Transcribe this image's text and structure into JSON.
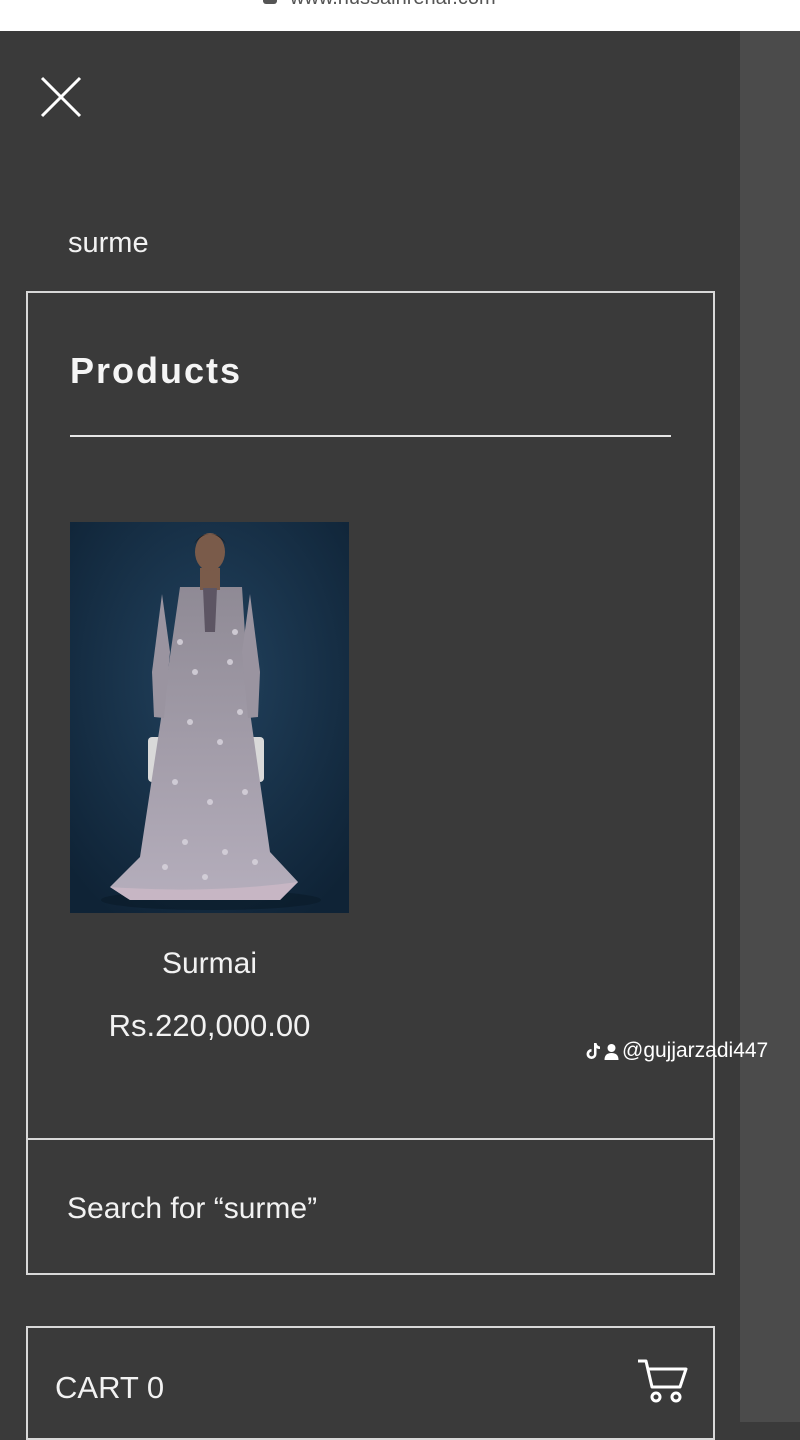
{
  "browser": {
    "url": "www.hussainrehar.com"
  },
  "search": {
    "query": "surme"
  },
  "results": {
    "heading": "Products",
    "products": [
      {
        "name": "Surmai",
        "price": "Rs.220,000.00"
      }
    ],
    "search_all_label": "Search for “surme”"
  },
  "cart": {
    "label": "CART 0"
  },
  "watermark": {
    "handle": "@gujjarzadi447"
  },
  "icons": {
    "close": "close-icon",
    "cart": "cart-icon",
    "lock": "lock-icon",
    "tiktok": "tiktok-icon",
    "user": "user-icon"
  },
  "colors": {
    "drawer_background": "#3a3a3a",
    "side_strip": "#4b4b4b",
    "border": "#d8d8d8",
    "text": "#f2f2f2",
    "product_backdrop": "#173049"
  }
}
